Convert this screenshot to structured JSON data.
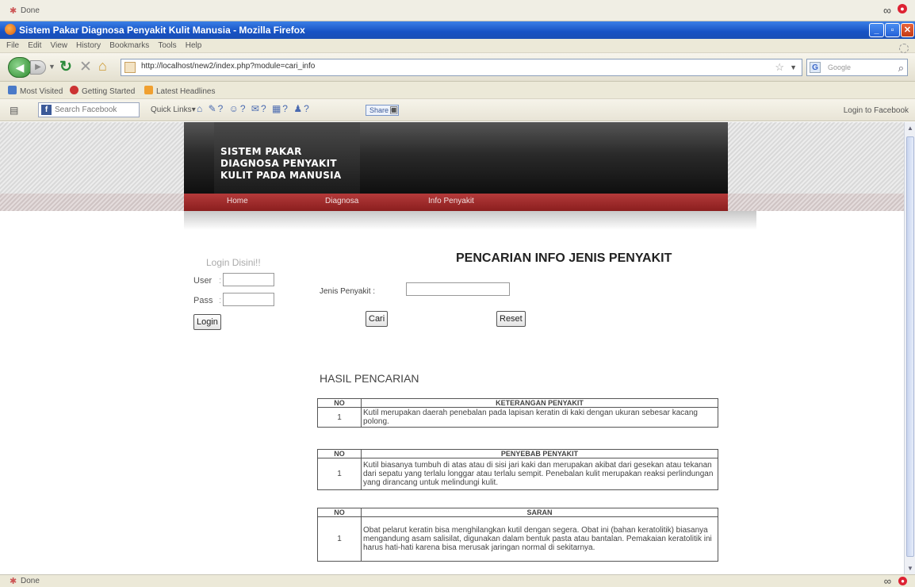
{
  "top_status": {
    "text": "Done"
  },
  "window": {
    "title": "Sistem Pakar Diagnosa Penyakit Kulit Manusia - Mozilla Firefox"
  },
  "menu": [
    "File",
    "Edit",
    "View",
    "History",
    "Bookmarks",
    "Tools",
    "Help"
  ],
  "nav": {
    "url": "http://localhost/new2/index.php?module=cari_info",
    "search_placeholder": "Google"
  },
  "bookmarks": [
    "Most Visited",
    "Getting Started",
    "Latest Headlines"
  ],
  "fb_toolbar": {
    "search_placeholder": "Search Facebook",
    "quick_links": "Quick Links",
    "share": "Share",
    "login": "Login to Facebook"
  },
  "site": {
    "header_lines": [
      "SISTEM PAKAR",
      "DIAGNOSA PENYAKIT",
      "KULIT PADA MANUSIA"
    ],
    "nav": [
      "Home",
      "Diagnosa",
      "Info Penyakit"
    ]
  },
  "login": {
    "title": "Login Disini!!",
    "user_label": "User",
    "pass_label": "Pass",
    "sep": ":",
    "button": "Login"
  },
  "search": {
    "title": "PENCARIAN INFO JENIS PENYAKIT",
    "label": "Jenis Penyakit :",
    "cari": "Cari",
    "reset": "Reset"
  },
  "results": {
    "title": "HASIL PENCARIAN",
    "tables": [
      {
        "col_no": "NO",
        "col_title": "KETERANGAN PENYAKIT",
        "no": "1",
        "text": "Kutil merupakan daerah penebalan pada lapisan keratin di kaki dengan ukuran sebesar kacang polong."
      },
      {
        "col_no": "NO",
        "col_title": "PENYEBAB PENYAKIT",
        "no": "1",
        "text": "Kutil biasanya tumbuh di atas atau di sisi jari kaki dan merupakan akibat dari gesekan atau tekanan dari sepatu yang terlalu longgar atau terlalu sempit. Penebalan kulit merupakan reaksi perlindungan yang dirancang untuk melindungi kulit."
      },
      {
        "col_no": "NO",
        "col_title": "SARAN",
        "no": "1",
        "text": "Obat pelarut keratin bisa menghilangkan kutil dengan segera. Obat ini (bahan keratolitik) biasanya mengandung asam salisilat, digunakan dalam bentuk pasta atau bantalan. Pemakaian keratolitik ini harus hati-hati karena bisa merusak jaringan normal di sekitarnya."
      }
    ]
  },
  "status": {
    "text": "Done"
  }
}
